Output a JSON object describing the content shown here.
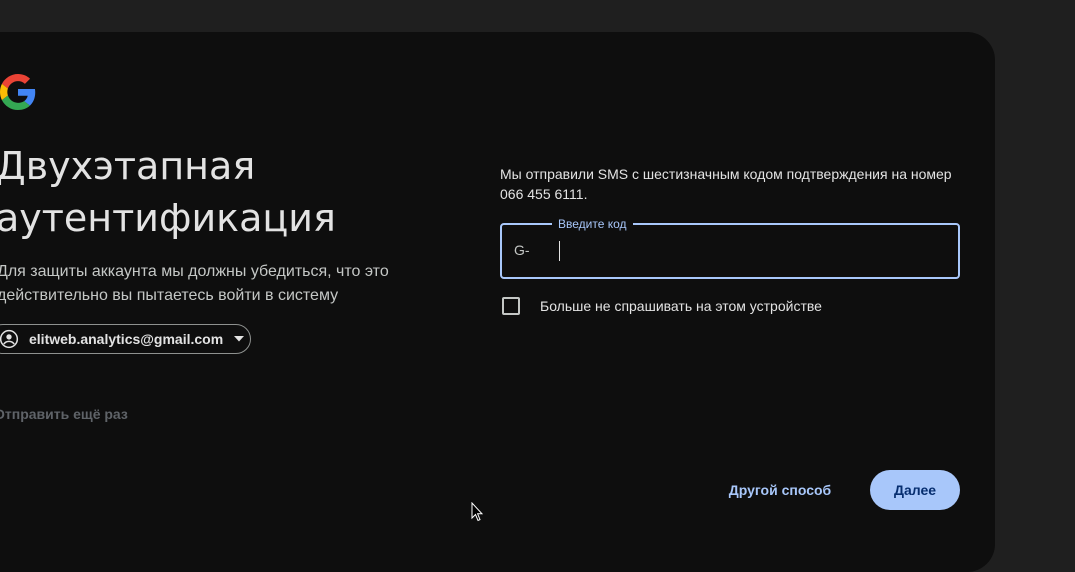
{
  "page": {
    "title": "Двухэтапная аутентификация",
    "subtitle": "Для защиты аккаунта мы должны убедиться, что это действительно вы пытаетесь войти в систему",
    "account_email": "elitweb.analytics@gmail.com",
    "resend_label": "Отправить ещё раз"
  },
  "form": {
    "info_text": "Мы отправили SMS с шестизначным кодом подтверждения на номер 066 455 6111.",
    "code_label": "Введите код",
    "code_prefix": "G-",
    "code_value": "",
    "remember_label": "Больше не спрашивать на этом устройстве",
    "remember_checked": false
  },
  "actions": {
    "other_label": "Другой способ",
    "next_label": "Далее"
  },
  "icons": {
    "logo": "google-logo",
    "avatar": "account-circle-icon",
    "dropdown": "caret-down-icon",
    "pointer": "mouse-pointer-icon"
  },
  "colors": {
    "background": "#1f1f1f",
    "card": "#0e0e0e",
    "accent": "#a8c7fa",
    "primary_button_text": "#062e6f",
    "text": "#e3e3e3",
    "muted": "#5f6368"
  }
}
